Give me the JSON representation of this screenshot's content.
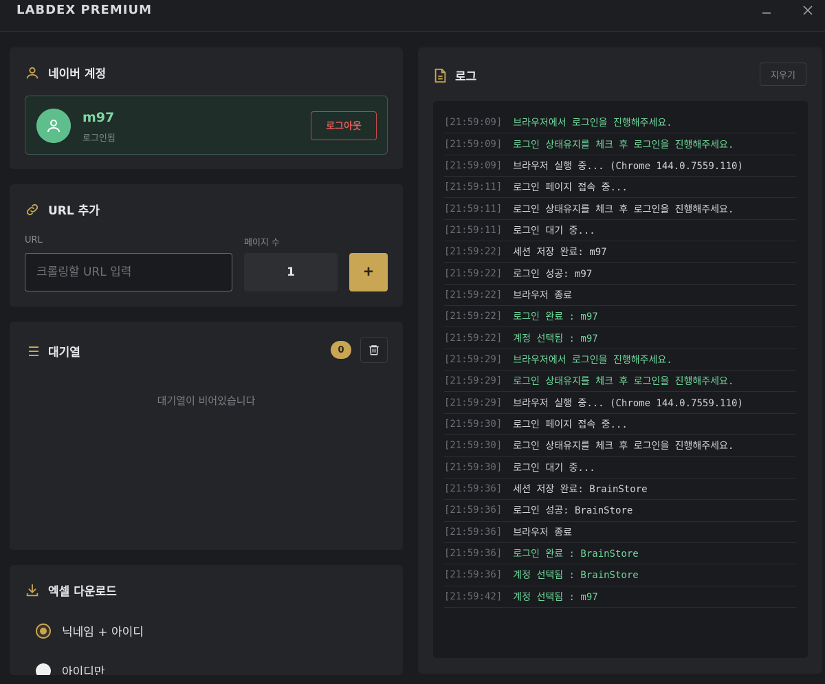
{
  "window": {
    "title": "LABDEX PREMIUM"
  },
  "account": {
    "heading": "네이버 계정",
    "username": "m97",
    "status": "로그인됨",
    "logout_label": "로그아웃"
  },
  "url_add": {
    "heading": "URL 추가",
    "url_label": "URL",
    "url_placeholder": "크롤링할 URL 입력",
    "pages_label": "페이지 수",
    "pages_value": "1",
    "add_label": "+"
  },
  "queue": {
    "heading": "대기열",
    "count": "0",
    "empty_text": "대기열이 비어있습니다"
  },
  "excel": {
    "heading": "엑셀 다운로드",
    "options": [
      {
        "label": "닉네임 + 아이디",
        "selected": true
      },
      {
        "label": "아이디만",
        "selected": false
      }
    ]
  },
  "log": {
    "heading": "로그",
    "clear_label": "지우기",
    "entries": [
      {
        "time": "[21:59:09]",
        "message": "브라우저에서 로그인을 진행해주세요.",
        "level": "success"
      },
      {
        "time": "[21:59:09]",
        "message": "로그인 상태유지를 체크 후 로그인을 진행해주세요.",
        "level": "success"
      },
      {
        "time": "[21:59:09]",
        "message": "브라우저 실행 중... (Chrome 144.0.7559.110)",
        "level": "info"
      },
      {
        "time": "[21:59:11]",
        "message": "로그인 페이지 접속 중...",
        "level": "info"
      },
      {
        "time": "[21:59:11]",
        "message": "로그인 상태유지를 체크 후 로그인을 진행해주세요.",
        "level": "info"
      },
      {
        "time": "[21:59:11]",
        "message": "로그인 대기 중...",
        "level": "info"
      },
      {
        "time": "[21:59:22]",
        "message": "세션 저장 완료: m97",
        "level": "info"
      },
      {
        "time": "[21:59:22]",
        "message": "로그인 성공: m97",
        "level": "info"
      },
      {
        "time": "[21:59:22]",
        "message": "브라우저 종료",
        "level": "info"
      },
      {
        "time": "[21:59:22]",
        "message": "로그인 완료 : m97",
        "level": "success"
      },
      {
        "time": "[21:59:22]",
        "message": "계정 선택됨 : m97",
        "level": "success"
      },
      {
        "time": "[21:59:29]",
        "message": "브라우저에서 로그인을 진행해주세요.",
        "level": "success"
      },
      {
        "time": "[21:59:29]",
        "message": "로그인 상태유지를 체크 후 로그인을 진행해주세요.",
        "level": "success"
      },
      {
        "time": "[21:59:29]",
        "message": "브라우저 실행 중... (Chrome 144.0.7559.110)",
        "level": "info"
      },
      {
        "time": "[21:59:30]",
        "message": "로그인 페이지 접속 중...",
        "level": "info"
      },
      {
        "time": "[21:59:30]",
        "message": "로그인 상태유지를 체크 후 로그인을 진행해주세요.",
        "level": "info"
      },
      {
        "time": "[21:59:30]",
        "message": "로그인 대기 중...",
        "level": "info"
      },
      {
        "time": "[21:59:36]",
        "message": "세션 저장 완료: BrainStore",
        "level": "info"
      },
      {
        "time": "[21:59:36]",
        "message": "로그인 성공: BrainStore",
        "level": "info"
      },
      {
        "time": "[21:59:36]",
        "message": "브라우저 종료",
        "level": "info"
      },
      {
        "time": "[21:59:36]",
        "message": "로그인 완료 : BrainStore",
        "level": "success"
      },
      {
        "time": "[21:59:36]",
        "message": "계정 선택됨 : BrainStore",
        "level": "success"
      },
      {
        "time": "[21:59:42]",
        "message": "계정 선택됨 : m97",
        "level": "success"
      }
    ]
  },
  "icons": {
    "user": "user-icon",
    "link": "link-icon",
    "list": "list-icon",
    "download": "download-icon",
    "document": "document-icon",
    "trash": "trash-icon"
  },
  "colors": {
    "accent_gold": "#c9a654",
    "success_green": "#6ed69a",
    "logout_red": "#e25a5a"
  }
}
